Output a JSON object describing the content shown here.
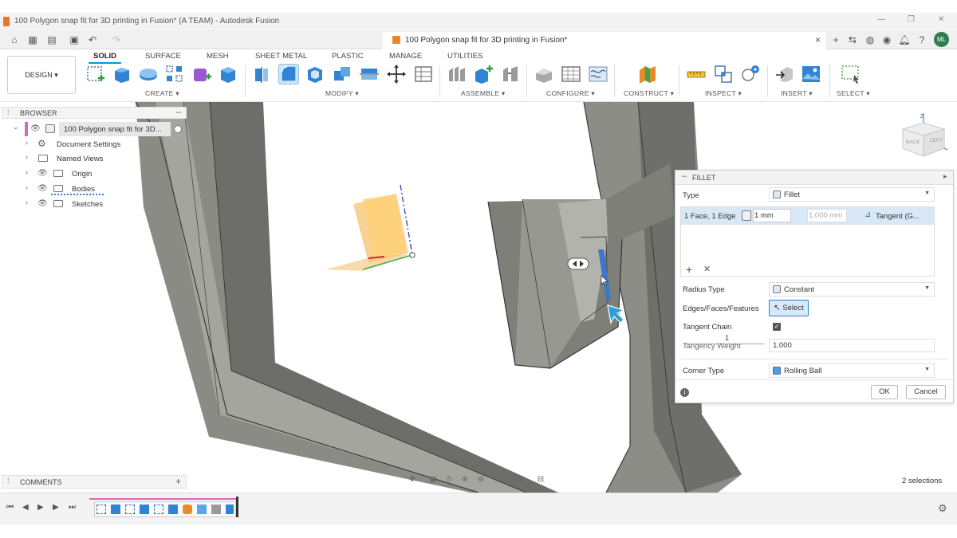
{
  "window": {
    "title": "100 Polygon snap fit for 3D printing in Fusion* (A TEAM) - Autodesk Fusion"
  },
  "document_tab": {
    "title": "100 Polygon snap fit for 3D printing in Fusion*"
  },
  "user": {
    "initials": "ML"
  },
  "workspace": {
    "label": "DESIGN ▾"
  },
  "menu_tabs": [
    "SOLID",
    "SURFACE",
    "MESH",
    "SHEET METAL",
    "PLASTIC",
    "MANAGE",
    "UTILITIES"
  ],
  "groups": [
    "CREATE ▾",
    "MODIFY ▾",
    "ASSEMBLE ▾",
    "CONFIGURE ▾",
    "CONSTRUCT ▾",
    "INSPECT ▾",
    "INSERT ▾",
    "SELECT ▾"
  ],
  "browser": {
    "header": "BROWSER",
    "root": "100 Polygon snap fit for 3D...",
    "items": [
      "Document Settings",
      "Named Views",
      "Origin",
      "Bodies",
      "Sketches"
    ]
  },
  "comments": {
    "label": "COMMENTS"
  },
  "viewcube": {
    "back": "BACK",
    "left": "LEFT",
    "axis": "Z"
  },
  "fillet": {
    "header": "FILLET",
    "type_label": "Type",
    "type_value": "Fillet",
    "selection_label": "1 Face, 1 Edge",
    "radius_value": "1 mm",
    "radius_placeholder": "1.000 mm",
    "tangent_label": "Tangent (G...",
    "radius_type_label": "Radius Type",
    "radius_type_value": "Constant",
    "edges_label": "Edges/Faces/Features",
    "select_label": "Select",
    "tangent_chain_label": "Tangent Chain",
    "slider_value": "1",
    "tangency_weight_label": "Tangency Weight",
    "tangency_weight_value": "1.000",
    "corner_type_label": "Corner Type",
    "corner_type_value": "Rolling Ball",
    "ok_label": "OK",
    "cancel_label": "Cancel"
  },
  "status": {
    "selections": "2 selections"
  },
  "colors": {
    "accent": "#0696d7",
    "body": "#8a8a84",
    "selection_blue": "#3a78c8"
  }
}
